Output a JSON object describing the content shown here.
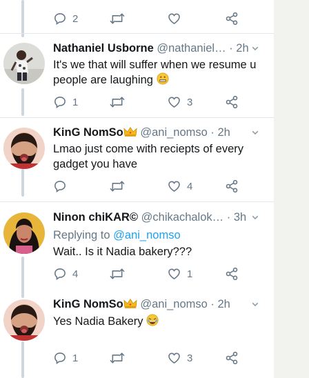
{
  "top_actions": {
    "reply_count": "2"
  },
  "tweets": [
    {
      "name": "Nathaniel Usborne",
      "handle": "@nathaniel…",
      "time": "· 2h",
      "text": "It's we that will suffer when we resume u people are laughing",
      "reply_count": "1",
      "retweet_count": "",
      "like_count": "3"
    },
    {
      "name": "KinG NomSo",
      "handle": "@ani_nomso",
      "time": "· 2h",
      "text": "Lmao just come with reciepts of every gadget you have",
      "reply_count": "",
      "retweet_count": "",
      "like_count": "4"
    },
    {
      "name": "Ninon chiKAR©",
      "handle": "@chikachalok…",
      "time": "· 3h",
      "replying_prefix": "Replying to",
      "replying_to": "@ani_nomso",
      "text": "Wait.. Is it Nadia bakery???",
      "reply_count": "4",
      "retweet_count": "",
      "like_count": "1"
    },
    {
      "name": "KinG NomSo",
      "handle": "@ani_nomso",
      "time": "· 2h",
      "text": "Yes Nadia Bakery",
      "reply_count": "1",
      "retweet_count": "",
      "like_count": "3"
    }
  ],
  "icons": {
    "reply": "reply-icon",
    "retweet": "retweet-icon",
    "like": "heart-icon",
    "share": "share-icon",
    "caret": "chevron-down-icon",
    "crown": "crown-emoji-icon",
    "grimace": "grimacing-emoji-icon",
    "laugh": "laughing-emoji-icon"
  },
  "colors": {
    "text": "#14171a",
    "muted": "#657786",
    "link": "#1da1f2",
    "thread_line": "#cdd7df",
    "divider": "#e1e8ed"
  }
}
